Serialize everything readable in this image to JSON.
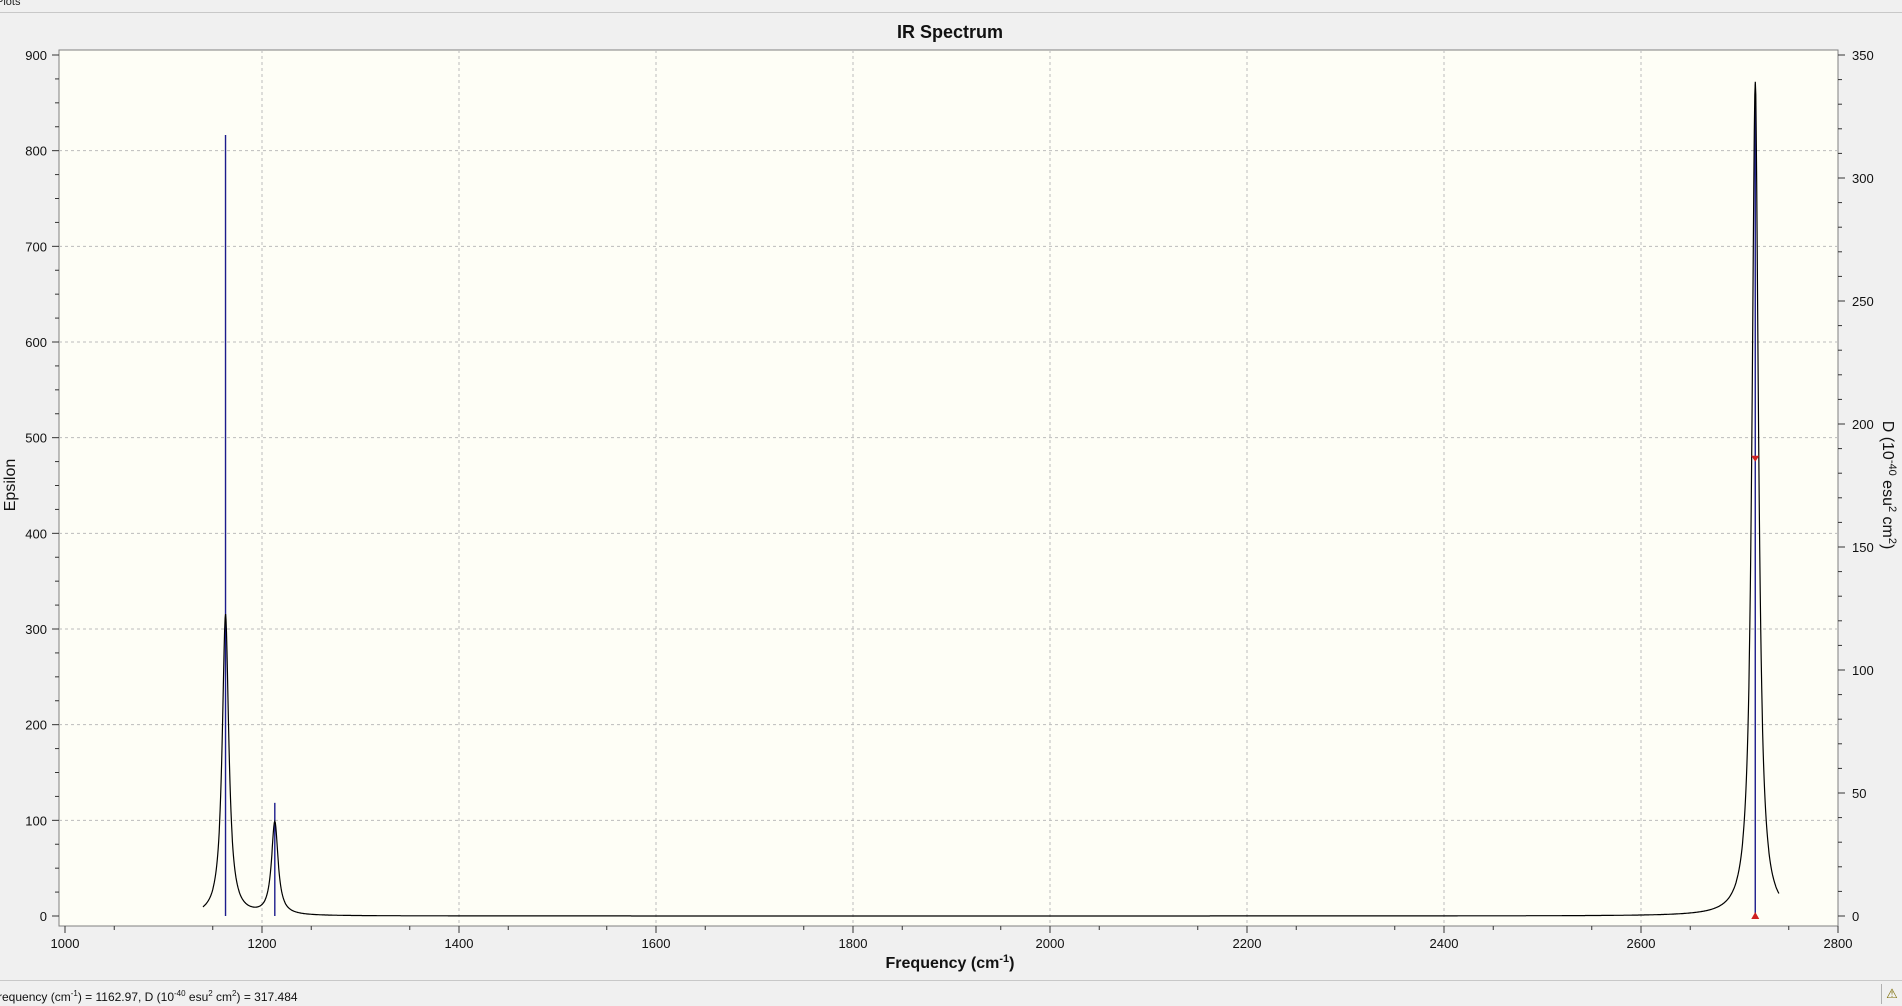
{
  "window": {
    "title": "Plots"
  },
  "status_bar": {
    "prefix": "requency (cm",
    "sup1": "-1",
    "mid1": ") = 1162.97, D (10",
    "sup2": "-40",
    "mid2": " esu",
    "sup3": "2",
    "mid3": " cm",
    "sup4": "2",
    "suffix": ") = 317.484",
    "help_icon": "lightbulb-question-icon"
  },
  "colors": {
    "plot_background": "#fefef6",
    "curve": "#000000",
    "stick": "#1c1c8c",
    "marker": "#d02020",
    "grid": "#bcbcbc"
  },
  "chart_data": {
    "type": "line",
    "title": "IR Spectrum",
    "xlabel_main": "Frequency (cm",
    "xlabel_sup": "-1",
    "xlabel_end": ")",
    "ylabel_left": "Epsilon",
    "ylabel_right_main": "D (10",
    "ylabel_right_sup1": "-40",
    "ylabel_right_mid": " esu",
    "ylabel_right_sup2": "2",
    "ylabel_right_mid2": " cm",
    "ylabel_right_sup3": "2",
    "ylabel_right_end": ")",
    "xlim": [
      1000,
      2800
    ],
    "ylim_left": [
      0,
      900
    ],
    "ylim_right": [
      0,
      350
    ],
    "x_ticks": [
      1000,
      1200,
      1400,
      1600,
      1800,
      2000,
      2200,
      2400,
      2600,
      2800
    ],
    "y_ticks_left": [
      0,
      100,
      200,
      300,
      400,
      500,
      600,
      700,
      800,
      900
    ],
    "y_ticks_right": [
      0,
      50,
      100,
      150,
      200,
      250,
      300,
      350
    ],
    "grid": true,
    "spectrum_peaks": [
      {
        "frequency": 1162.97,
        "epsilon_max": 315
      },
      {
        "frequency": 1213,
        "epsilon_max": 97
      },
      {
        "frequency": 2716,
        "epsilon_max": 872
      }
    ],
    "spectrum_range": [
      1140,
      2740
    ],
    "sticks": [
      {
        "frequency": 1162.97,
        "D": 317.484
      },
      {
        "frequency": 1213,
        "D": 46
      },
      {
        "frequency": 2716,
        "D": 338
      }
    ],
    "selected_marker": {
      "frequency": 2716,
      "epsilon": 478
    }
  }
}
